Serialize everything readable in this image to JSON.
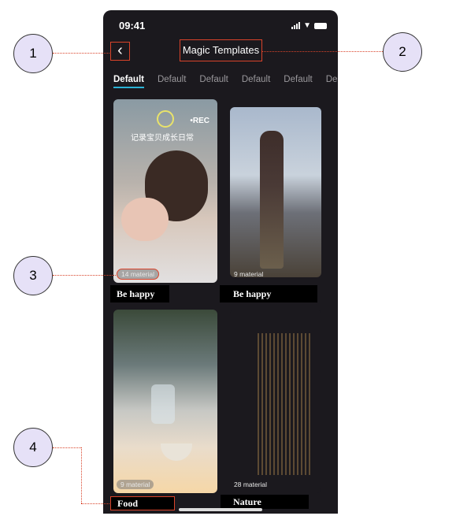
{
  "status_bar": {
    "time": "09:41"
  },
  "header": {
    "back_icon": "chevron-left-icon",
    "title": "Magic Templates"
  },
  "tabs": [
    {
      "label": "Default",
      "active": true
    },
    {
      "label": "Default"
    },
    {
      "label": "Default"
    },
    {
      "label": "Default"
    },
    {
      "label": "Default"
    },
    {
      "label": "De"
    }
  ],
  "templates": [
    {
      "name": "Be happy",
      "count": "14 material",
      "overlay_text": "记录宝贝成长日常",
      "rec_text": "•REC"
    },
    {
      "name": "Be happy",
      "count": "9 material"
    },
    {
      "name": "Food",
      "count": "9 material"
    },
    {
      "name": "Nature",
      "count": "28 material"
    }
  ],
  "annotations": [
    "1",
    "2",
    "3",
    "4"
  ],
  "colors": {
    "highlight": "#d9432a",
    "tab_indicator": "#2bb3d6",
    "annotation_fill": "#e6e1f7"
  }
}
